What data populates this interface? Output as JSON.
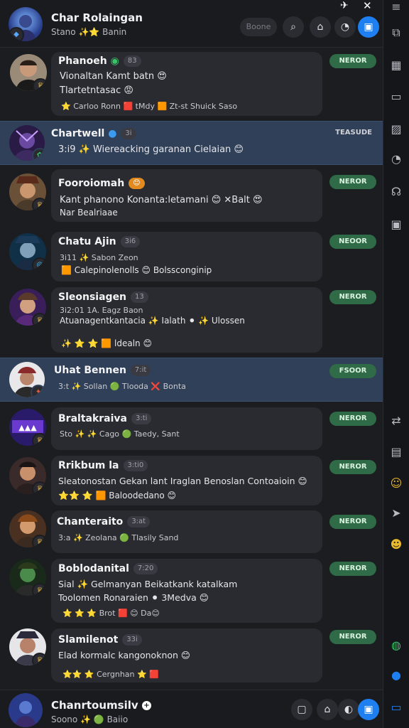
{
  "header": {
    "title": "Char Rolaingan",
    "subtitle": "Stano ✨⭐ Banin",
    "search_placeholder": "Boone",
    "top_icons": {
      "pin": "✈",
      "close": "✕"
    }
  },
  "rows": [
    {
      "name": "Phanoeh",
      "tag": "83",
      "status": "NEROR",
      "line1": "Vionaltan Kamt batn 😍",
      "line2": "Tlartetntasac 😡",
      "line3": "⭐ Carloo Ronn 🟥 tMdy 🟧 Zt-st Shuick Saso"
    },
    {
      "name": "Chartwell",
      "tag": "3i",
      "time": "TEASUDE",
      "line1": "3:i9 ✨ Wiereacking garanan Cielaian 😊"
    },
    {
      "name": "Fooroiomah",
      "tag": "😊",
      "status": "NEROR",
      "line1": "Kant phanono Konanta:letamani 😊 ✕Balt 😍",
      "line2": "Nar Bealriaae"
    },
    {
      "name": "Chatu Ajin",
      "tag": "3i6",
      "status": "NEOOR",
      "line1": "3i11 ✨ Sabon Zeon",
      "line2": "🟧 Calepinolenolls 😊 Bolssconginip"
    },
    {
      "name": "Sleonsiagen",
      "tag": "13",
      "status": "NEROR",
      "line1": "3i2:01 1A. Eagz Baon",
      "line2": "Atuanagentkantacia ✨ Ialath ⚫ ✨ Ulossen",
      "line3": "✨ ⭐ ⭐ 🟧 ldealn 😊"
    },
    {
      "name": "Uhat Bennen",
      "tag": "7:it",
      "status": "FSOOR",
      "line1": "3:t ✨ Sollan 🟢 Tlooda ❌ Bonta"
    },
    {
      "name": "Braltakraiva",
      "tag": "3:ti",
      "status": "NEROR",
      "line1": "Sto ✨ ✨ Cago 🟢 Taedy, Sant"
    },
    {
      "name": "Rrikbum la",
      "tag": "3:ti0",
      "status": "NEROR",
      "line1": "Sleatonostan Gekan lant Iraglan Benoslan Contoaioin 😊",
      "line2": "⭐⭐ ⭐ 🟧 Baloodedano 😊"
    },
    {
      "name": "Chanteraito",
      "tag": "3:at",
      "status": "NEROR",
      "line1": "3:a ✨ Zeolana 🟢 Tlasily Sand"
    },
    {
      "name": "Boblodanital",
      "tag": "7:20",
      "status": "NEROR",
      "line1": "Sial ✨ Gelmanyan Beikatkank katalkam",
      "line2": "Toolomen Ronaraien ⚫ 3Medva 😊",
      "line3": "⭐ ⭐ ⭐ Brot 🟥 😊 Da😊"
    },
    {
      "name": "Slamilenot",
      "tag": "33i",
      "status": "NEROR",
      "line1": "Elad kormalc kangonoknon 😊",
      "line2": "⭐⭐ ⭐ Cergnhan ⭐ 🟥"
    }
  ],
  "footer": {
    "title": "Chanrtoumsilv",
    "subtitle": "Soono ✨ 🟢 Baiio"
  },
  "colors": {
    "accent": "#1e7ff0",
    "status_green": "#2f6b46",
    "selected_row": "#2f4058"
  }
}
